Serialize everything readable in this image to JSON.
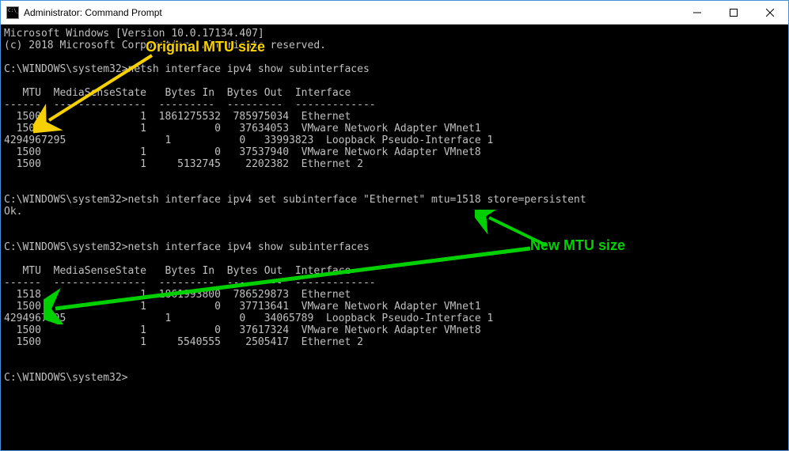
{
  "window": {
    "title": "Administrator: Command Prompt"
  },
  "banner": {
    "line1": "Microsoft Windows [Version 10.0.17134.407]",
    "line2": "(c) 2018 Microsoft Corporation. All rights reserved."
  },
  "prompt": "C:\\WINDOWS\\system32>",
  "commands": {
    "cmd1": "netsh interface ipv4 show subinterfaces",
    "cmd2": "netsh interface ipv4 set subinterface \"Ethernet\" mtu=1518 store=persistent",
    "cmd2_result": "Ok.",
    "cmd3": "netsh interface ipv4 show subinterfaces"
  },
  "table_header": {
    "mtu": "MTU",
    "media": "MediaSenseState",
    "bytesin": "Bytes In",
    "bytesout": "Bytes Out",
    "iface": "Interface"
  },
  "table1": [
    {
      "mtu": "1500",
      "mss": "1",
      "bin": "1861275532",
      "bout": "785975034",
      "iface": "Ethernet"
    },
    {
      "mtu": "1500",
      "mss": "1",
      "bin": "0",
      "bout": "37634053",
      "iface": "VMware Network Adapter VMnet1"
    },
    {
      "mtu": "4294967295",
      "mss": "1",
      "bin": "0",
      "bout": "33993823",
      "iface": "Loopback Pseudo-Interface 1"
    },
    {
      "mtu": "1500",
      "mss": "1",
      "bin": "0",
      "bout": "37537940",
      "iface": "VMware Network Adapter VMnet8"
    },
    {
      "mtu": "1500",
      "mss": "1",
      "bin": "5132745",
      "bout": "2202382",
      "iface": "Ethernet 2"
    }
  ],
  "table2": [
    {
      "mtu": "1518",
      "mss": "1",
      "bin": "1861993800",
      "bout": "786529873",
      "iface": "Ethernet"
    },
    {
      "mtu": "1500",
      "mss": "1",
      "bin": "0",
      "bout": "37713641",
      "iface": "VMware Network Adapter VMnet1"
    },
    {
      "mtu": "4294967295",
      "mss": "1",
      "bin": "0",
      "bout": "34065789",
      "iface": "Loopback Pseudo-Interface 1"
    },
    {
      "mtu": "1500",
      "mss": "1",
      "bin": "0",
      "bout": "37617324",
      "iface": "VMware Network Adapter VMnet8"
    },
    {
      "mtu": "1500",
      "mss": "1",
      "bin": "5540555",
      "bout": "2505417",
      "iface": "Ethernet 2"
    }
  ],
  "annotations": {
    "original": "Original MTU size",
    "new": "New MTU size"
  }
}
